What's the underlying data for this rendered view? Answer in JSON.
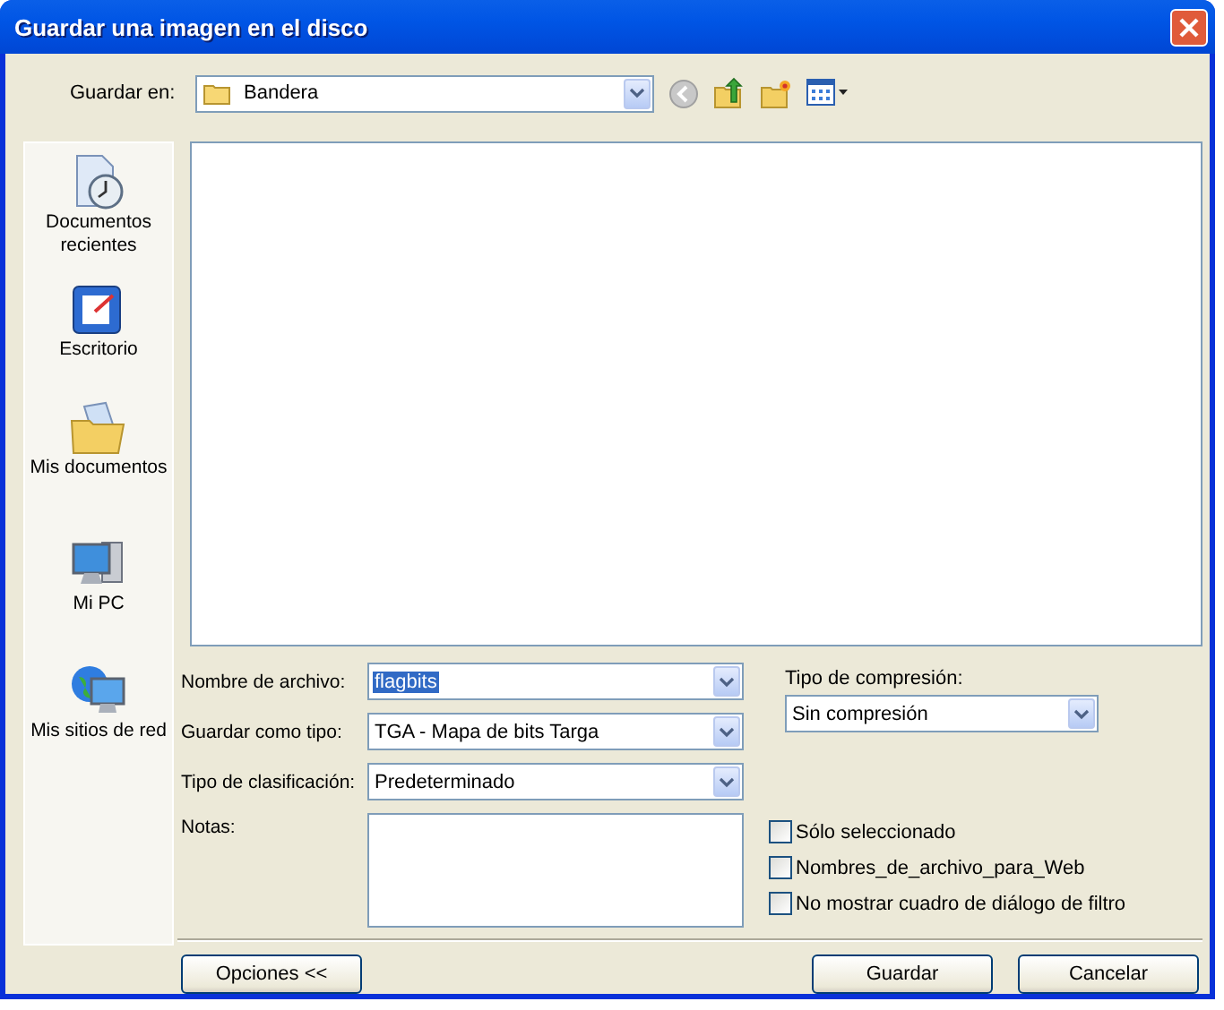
{
  "window": {
    "title": "Guardar una imagen en el disco"
  },
  "save_in": {
    "label": "Guardar en:",
    "value": "Bandera"
  },
  "places": [
    {
      "label": "Documentos recientes",
      "kind": "recent"
    },
    {
      "label": "Escritorio",
      "kind": "desktop"
    },
    {
      "label": "Mis documentos",
      "kind": "documents"
    },
    {
      "label": "Mi PC",
      "kind": "computer"
    },
    {
      "label": "Mis sitios de red",
      "kind": "network"
    }
  ],
  "fields": [
    {
      "label": "Nombre de archivo:",
      "value": "flagbits",
      "selected": true
    },
    {
      "label": "Guardar como tipo:",
      "value": "TGA - Mapa de bits Targa",
      "selected": false
    },
    {
      "label": "Tipo de clasificación:",
      "value": "Predeterminado",
      "selected": false
    }
  ],
  "notes": {
    "label": "Notas:"
  },
  "compression": {
    "label": "Tipo de compresión:",
    "value": "Sin compresión"
  },
  "options": [
    {
      "label": "Sólo seleccionado",
      "checked": false
    },
    {
      "label": "Nombres_de_archivo_para_Web",
      "checked": false
    },
    {
      "label": "No mostrar cuadro de diálogo de filtro",
      "checked": false
    }
  ],
  "buttons": [
    {
      "label": "Opciones <<"
    },
    {
      "label": "Guardar"
    },
    {
      "label": "Cancelar"
    }
  ]
}
